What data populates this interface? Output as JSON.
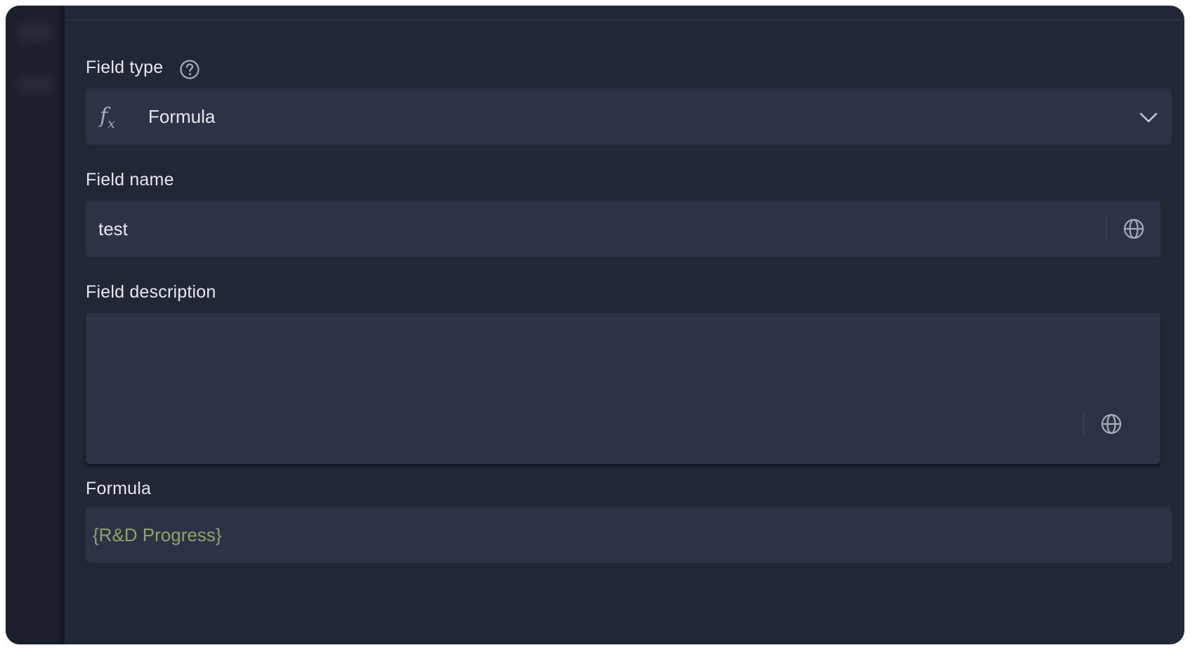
{
  "form": {
    "field_type": {
      "label": "Field type",
      "help_icon": "question-circle-icon",
      "type_icon": "function-fx-icon",
      "selected_value": "Formula",
      "dropdown_icon": "chevron-down-icon"
    },
    "field_name": {
      "label": "Field name",
      "value": "test",
      "translate_icon": "globe-icon"
    },
    "field_description": {
      "label": "Field description",
      "value": "",
      "translate_icon": "globe-icon"
    },
    "formula": {
      "label": "Formula",
      "value": "{R&D Progress}",
      "value_color": "#8ea364"
    }
  },
  "colors": {
    "background": "#222736",
    "input_background": "#2d3247",
    "text": "#e6e8ee",
    "icon": "#a6abba"
  }
}
